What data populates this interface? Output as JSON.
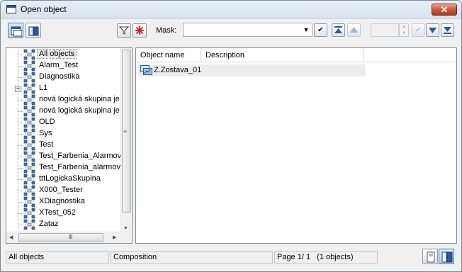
{
  "window": {
    "title": "Open object",
    "close_label": "✕"
  },
  "toolbar": {
    "mask_label": "Mask:",
    "mask_value": "",
    "filter_icon": "filter-icon",
    "clear_filter_icon": "asterisk-icon"
  },
  "tree": {
    "items": [
      {
        "label": "All objects",
        "selected": true,
        "expandable": false
      },
      {
        "label": "Alarm_Test",
        "expandable": false
      },
      {
        "label": "Diagnostika",
        "expandable": false
      },
      {
        "label": "L1",
        "expandable": true
      },
      {
        "label": "nová logická skupina je",
        "expandable": false
      },
      {
        "label": "nová logická skupina je",
        "expandable": false
      },
      {
        "label": "OLD",
        "expandable": false
      },
      {
        "label": "Sys",
        "expandable": false
      },
      {
        "label": "Test",
        "expandable": false
      },
      {
        "label": "Test_Farbenia_Alarmov_",
        "expandable": false
      },
      {
        "label": "Test_Farbenia_alarmov1",
        "expandable": false
      },
      {
        "label": "tttLogickaSkupina",
        "expandable": false
      },
      {
        "label": "X000_Tester",
        "expandable": false
      },
      {
        "label": "XDiagnostika",
        "expandable": false
      },
      {
        "label": "XTest_052",
        "expandable": false
      },
      {
        "label": "Zataz",
        "expandable": false
      }
    ]
  },
  "list": {
    "columns": [
      "Object name",
      "Description"
    ],
    "rows": [
      {
        "name": "Z.Zostava_01",
        "description": ""
      }
    ]
  },
  "status": {
    "group": "All objects",
    "type": "Composition",
    "page": "Page  1/ 1",
    "count": "(1 objects)"
  },
  "colors": {
    "accent": "#3c7fb1",
    "close": "#c85a3c"
  }
}
